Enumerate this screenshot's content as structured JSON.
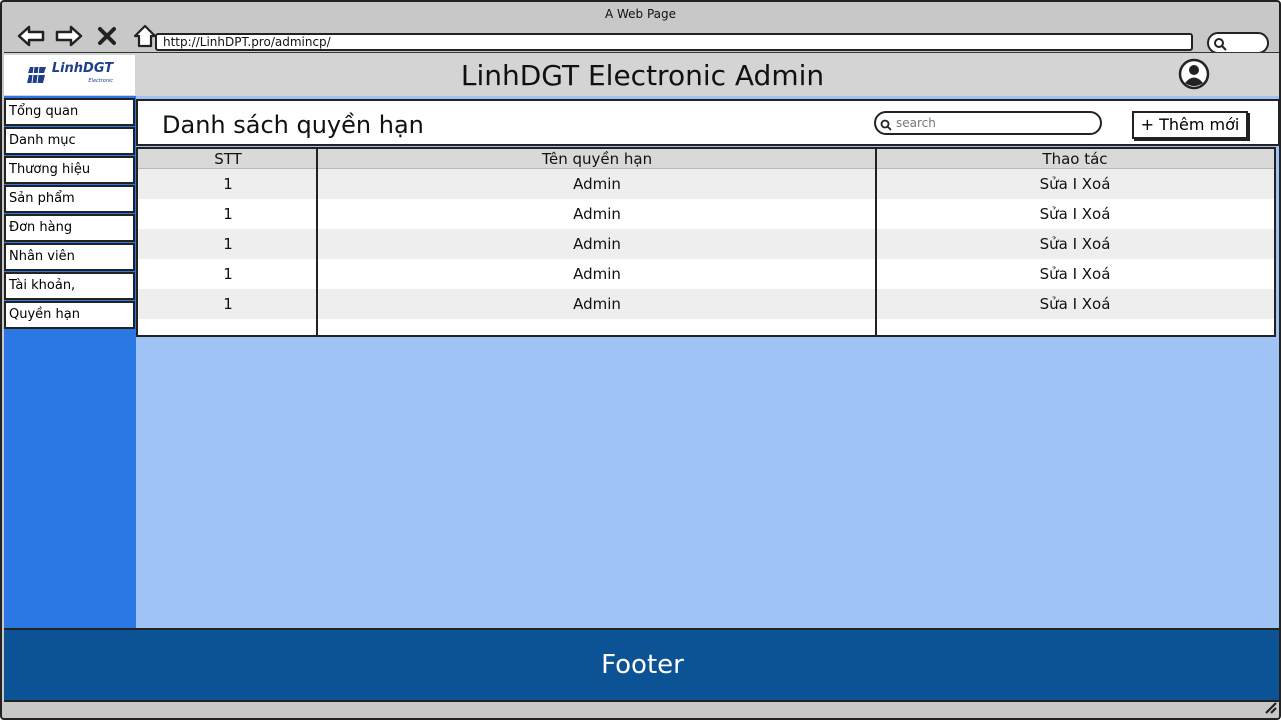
{
  "browser": {
    "page_title": "A Web Page",
    "url": "http://LinhDPT.pro/admincp/"
  },
  "header": {
    "logo_text": "LinhDGT",
    "logo_subtext": "Electronic",
    "title": "LinhDGT Electronic Admin"
  },
  "sidebar": {
    "items": [
      {
        "label": "Tổng quan"
      },
      {
        "label": "Danh mục"
      },
      {
        "label": "Thương hiệu"
      },
      {
        "label": "Sản phẩm"
      },
      {
        "label": "Đơn hàng"
      },
      {
        "label": "Nhân viên"
      },
      {
        "label": "Tài khoản,"
      },
      {
        "label": "Quyền hạn"
      }
    ]
  },
  "main": {
    "title": "Danh sách quyền hạn",
    "search_placeholder": "search",
    "add_label": "+ Thêm mới",
    "table": {
      "columns": [
        "STT",
        "Tên quyền hạn",
        "Thao tác"
      ],
      "rows": [
        {
          "stt": "1",
          "name": "Admin",
          "action": "Sửa I Xoá"
        },
        {
          "stt": "1",
          "name": "Admin",
          "action": "Sửa I Xoá"
        },
        {
          "stt": "1",
          "name": "Admin",
          "action": "Sửa I Xoá"
        },
        {
          "stt": "1",
          "name": "Admin",
          "action": "Sửa I Xoá"
        },
        {
          "stt": "1",
          "name": "Admin",
          "action": "Sửa I Xoá"
        }
      ]
    }
  },
  "footer": {
    "label": "Footer"
  },
  "colors": {
    "sidebar": "#2b78e4",
    "main_bg": "#a0c3f5",
    "footer": "#0b5394",
    "header": "#d4d4d4"
  }
}
